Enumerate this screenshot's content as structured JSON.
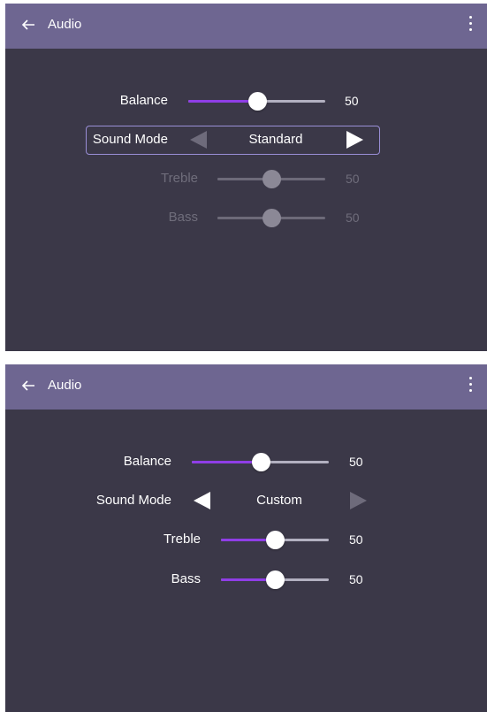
{
  "panels": [
    {
      "header": {
        "title": "Audio",
        "back_icon": "back-arrow-icon",
        "menu_icon": "more-vert-icon"
      },
      "balance": {
        "label": "Balance",
        "value": "50",
        "level": 0.5
      },
      "sound_mode": {
        "label": "Sound Mode",
        "value": "Standard"
      },
      "treble": {
        "label": "Treble",
        "value": "50",
        "level": 0.5,
        "enabled": false
      },
      "bass": {
        "label": "Bass",
        "value": "50",
        "level": 0.5,
        "enabled": false
      }
    },
    {
      "header": {
        "title": "Audio",
        "back_icon": "back-arrow-icon",
        "menu_icon": "more-vert-icon"
      },
      "balance": {
        "label": "Balance",
        "value": "50",
        "level": 0.5
      },
      "sound_mode": {
        "label": "Sound Mode",
        "value": "Custom"
      },
      "treble": {
        "label": "Treble",
        "value": "50",
        "level": 0.5,
        "enabled": true
      },
      "bass": {
        "label": "Bass",
        "value": "50",
        "level": 0.5,
        "enabled": true
      }
    }
  ],
  "colors": {
    "header": "#6e6691",
    "background": "#3b3848",
    "slider_fill": "#8f3ee6",
    "slider_track": "#b2b0c0",
    "focus_border": "#9a8ed6"
  }
}
